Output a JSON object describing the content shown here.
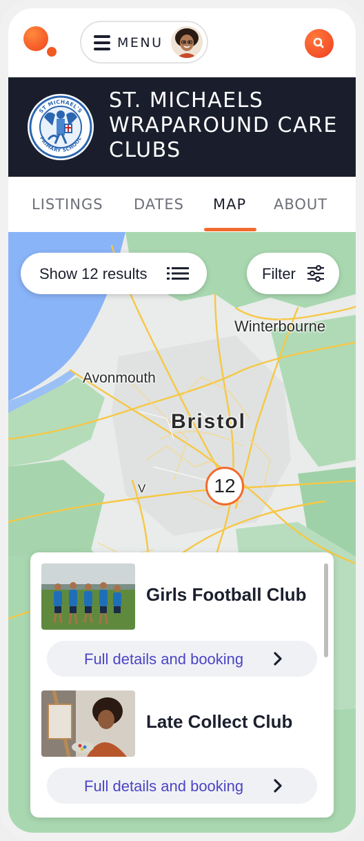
{
  "header": {
    "menu_label": "MENU",
    "icons": {
      "logo": "brand-logo-icon",
      "menu": "hamburger-icon",
      "search": "search-icon"
    }
  },
  "banner": {
    "school_name": "ST. MICHAELS WRAPAROUND CARE CLUBS",
    "crest_top_text": "ST MICHAEL'S",
    "crest_bottom_text": "PRIMARY SCHOOL"
  },
  "tabs": [
    {
      "label": "LISTINGS"
    },
    {
      "label": "DATES"
    },
    {
      "label": "MAP",
      "active": true
    },
    {
      "label": "ABOUT"
    }
  ],
  "map": {
    "places": {
      "bristol": "Bristol",
      "avonmouth": "Avonmouth",
      "winterbourne": "Winterbourne",
      "small_label": "V"
    },
    "cluster_count": "12",
    "show_results_label": "Show 12 results",
    "filter_label": "Filter"
  },
  "listings": [
    {
      "title": "Girls Football Club",
      "button_label": "Full details and booking"
    },
    {
      "title": "Late Collect Club",
      "button_label": "Full details and booking"
    }
  ],
  "colors": {
    "accent": "#f26a2b",
    "banner": "#1a1e2c",
    "link": "#4a45c4",
    "map_green": "#a9d8b0",
    "map_water": "#8ab4f8",
    "map_road": "#f7c744"
  }
}
